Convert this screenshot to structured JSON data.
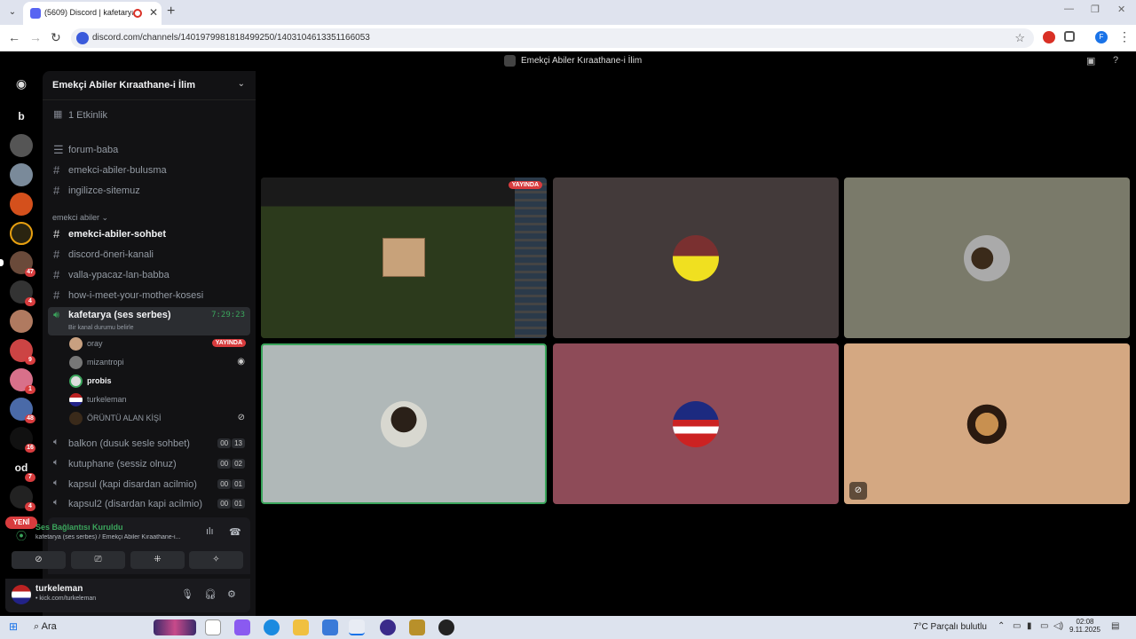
{
  "browser": {
    "tab_title": "(5609) Discord | kafetarya (s",
    "tab_close": "✕",
    "new_tab": "+",
    "url": "discord.com/channels/1401979981818499250/1403104613351166053",
    "profile_initial": "F"
  },
  "discord": {
    "window_title": "Emekçi Abiler Kıraathane-i İlim",
    "server_name": "Emekçi Abiler Kıraathane-i İlim",
    "events": "1 Etkinlik",
    "rail": {
      "letter_b": "b",
      "letter_od": "od",
      "badges": [
        "47",
        "4",
        "9",
        "1",
        "48",
        "16",
        "7",
        "4"
      ],
      "new_label": "YENİ"
    },
    "channels_top": [
      "forum-baba",
      "emekci-abiler-bulusma",
      "ingilizce-sitemuz"
    ],
    "category": "emekci abiler",
    "channels": [
      "emekci-abiler-sohbet",
      "discord-öneri-kanali",
      "valla-ypacaz-lan-babba",
      "how-i-meet-your-mother-kosesi"
    ],
    "active_voice": {
      "name": "kafetarya (ses serbes)",
      "time": "7:29:23",
      "status": "Bir kanal durumu belirle"
    },
    "members": [
      {
        "name": "oray",
        "live": "YAYINDA"
      },
      {
        "name": "mizantropi"
      },
      {
        "name": "probis"
      },
      {
        "name": "turkeleman"
      },
      {
        "name": "ÖRÜNTÜ ALAN KİŞİ"
      }
    ],
    "voice_channels": [
      {
        "name": "balkon (dusuk sesle sohbet)",
        "c1": "00",
        "c2": "13"
      },
      {
        "name": "kutuphane (sessiz olnuz)",
        "c1": "00",
        "c2": "02"
      },
      {
        "name": "kapsul (kapi disardan acilmio)",
        "c1": "00",
        "c2": "01"
      },
      {
        "name": "kapsul2 (disardan kapi acilmio)",
        "c1": "00",
        "c2": "01"
      }
    ],
    "voice_panel": {
      "status": "Ses Bağlantısı Kuruldu",
      "path": "kafetarya (ses serbes) / Emekçi Abiler Kıraathane-i..."
    },
    "user": {
      "name": "turkeleman",
      "status": "• kick.com/turkeleman"
    },
    "stage": {
      "live_label": "YAYINDA"
    }
  },
  "taskbar": {
    "search": "Ara",
    "weather": "7°C  Parçalı bulutlu",
    "time": "02:08",
    "date": "9.11.2025"
  },
  "colors": {
    "accent_green": "#3ba55c",
    "live_red": "#d83c3e",
    "blurple": "#5865f2"
  }
}
